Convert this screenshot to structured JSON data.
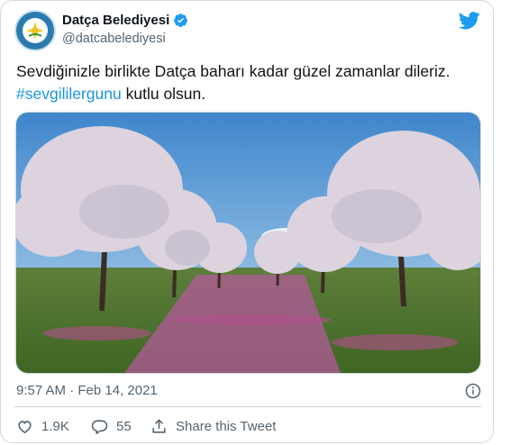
{
  "tweet": {
    "display_name": "Datça Belediyesi",
    "handle": "@datcabelediyesi",
    "text_line1": "Sevdiğinizle birlikte Datça baharı kadar güzel zamanlar dileriz.",
    "hashtag": "#sevgililergunu",
    "text_line2_rest": " kutlu olsun.",
    "timestamp": "9:57 AM · Feb 14, 2021",
    "likes": "1.9K",
    "replies": "55",
    "share_label": "Share this Tweet"
  },
  "icons": {
    "avatar": "municipality-logo",
    "verified": "verified-badge-icon",
    "brand": "twitter-bird-icon",
    "info": "info-icon",
    "like": "heart-icon",
    "reply": "reply-icon",
    "share": "share-icon"
  },
  "colors": {
    "link": "#1b95e0",
    "brand": "#1d9bf0",
    "muted": "#536471",
    "border": "#cfd9de"
  }
}
